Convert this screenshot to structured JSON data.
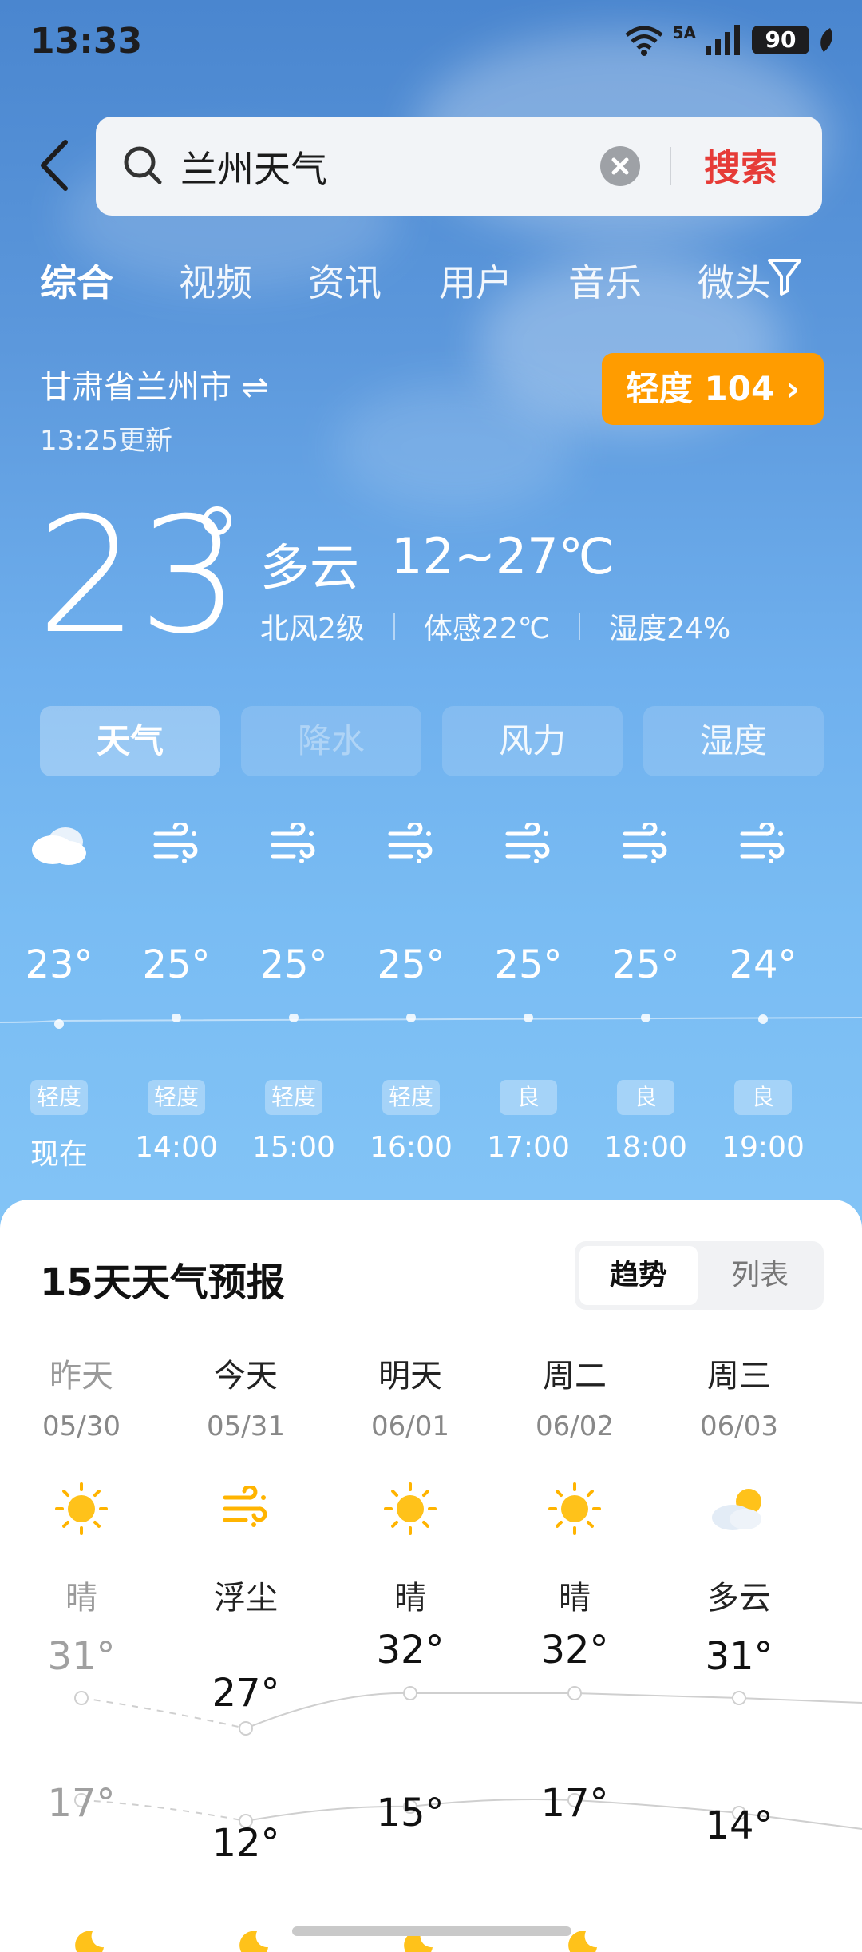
{
  "status": {
    "time": "13:33",
    "net": "5A",
    "battery": "90"
  },
  "search": {
    "query": "兰州天气",
    "button": "搜索"
  },
  "tabs": [
    "综合",
    "视频",
    "资讯",
    "用户",
    "音乐",
    "微头"
  ],
  "location": {
    "city": "甘肃省兰州市 ⇌",
    "updated": "13:25更新"
  },
  "aqi": {
    "label": "轻度 104 ›",
    "color": "#ff9c00"
  },
  "current": {
    "temp": "23",
    "condition": "多云",
    "range": "12~27℃",
    "wind": "北风2级",
    "feels": "体感22℃",
    "humidity": "湿度24%"
  },
  "segments": [
    "天气",
    "降水",
    "风力",
    "湿度"
  ],
  "hourly": [
    {
      "icon": "cloud-icon",
      "temp": "23°",
      "aqi": "轻度",
      "time": "现在"
    },
    {
      "icon": "dust-wind-icon",
      "temp": "25°",
      "aqi": "轻度",
      "time": "14:00"
    },
    {
      "icon": "dust-wind-icon",
      "temp": "25°",
      "aqi": "轻度",
      "time": "15:00"
    },
    {
      "icon": "dust-wind-icon",
      "temp": "25°",
      "aqi": "轻度",
      "time": "16:00"
    },
    {
      "icon": "dust-wind-icon",
      "temp": "25°",
      "aqi": "良",
      "time": "17:00"
    },
    {
      "icon": "dust-wind-icon",
      "temp": "25°",
      "aqi": "良",
      "time": "18:00"
    },
    {
      "icon": "dust-wind-icon",
      "temp": "24°",
      "aqi": "良",
      "time": "19:00"
    }
  ],
  "forecast": {
    "title": "15天天气预报",
    "toggle": [
      "趋势",
      "列表"
    ],
    "days": [
      {
        "name": "昨天",
        "date": "05/30",
        "icon": "sun-icon",
        "cond": "晴",
        "hi": "31°",
        "lo": "17°"
      },
      {
        "name": "今天",
        "date": "05/31",
        "icon": "dust-wind-icon",
        "cond": "浮尘",
        "hi": "27°",
        "lo": "12°"
      },
      {
        "name": "明天",
        "date": "06/01",
        "icon": "sun-icon",
        "cond": "晴",
        "hi": "32°",
        "lo": "15°"
      },
      {
        "name": "周二",
        "date": "06/02",
        "icon": "sun-icon",
        "cond": "晴",
        "hi": "32°",
        "lo": "17°"
      },
      {
        "name": "周三",
        "date": "06/03",
        "icon": "partly-cloudy-icon",
        "cond": "多云",
        "hi": "31°",
        "lo": "14°"
      }
    ]
  }
}
